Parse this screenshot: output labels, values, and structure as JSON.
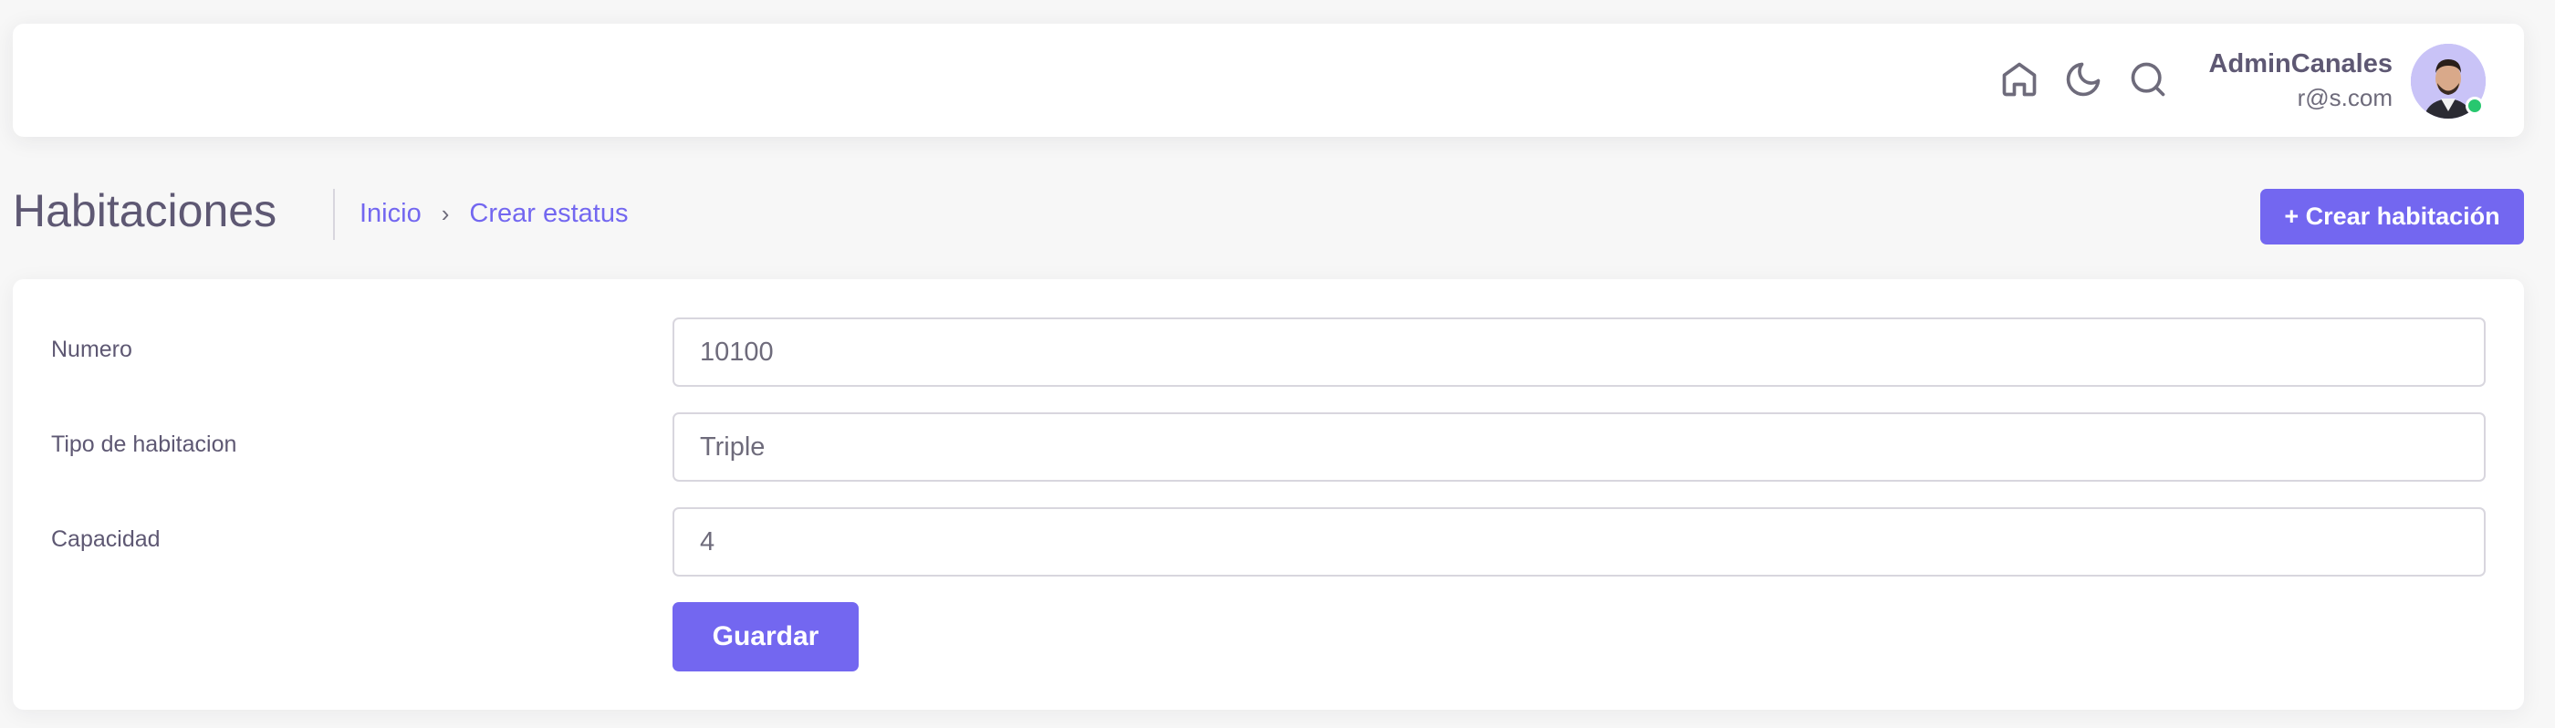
{
  "header": {
    "icons": [
      "home-icon",
      "moon-icon",
      "search-icon"
    ],
    "user": {
      "name": "AdminCanales",
      "email": "r@s.com",
      "status_color": "#28c76f"
    }
  },
  "page": {
    "title": "Habitaciones",
    "breadcrumb": {
      "home": "Inicio",
      "separator": "›",
      "current": "Crear estatus"
    },
    "create_button": "+ Crear habitación"
  },
  "form": {
    "numero": {
      "label": "Numero",
      "value": "10100"
    },
    "tipo": {
      "label": "Tipo de habitacion",
      "value": "Triple"
    },
    "capacidad": {
      "label": "Capacidad",
      "value": "4"
    },
    "save_button": "Guardar"
  },
  "theme": {
    "accent": "#7367f0",
    "text": "#5e5873",
    "border": "#d8d6de"
  }
}
